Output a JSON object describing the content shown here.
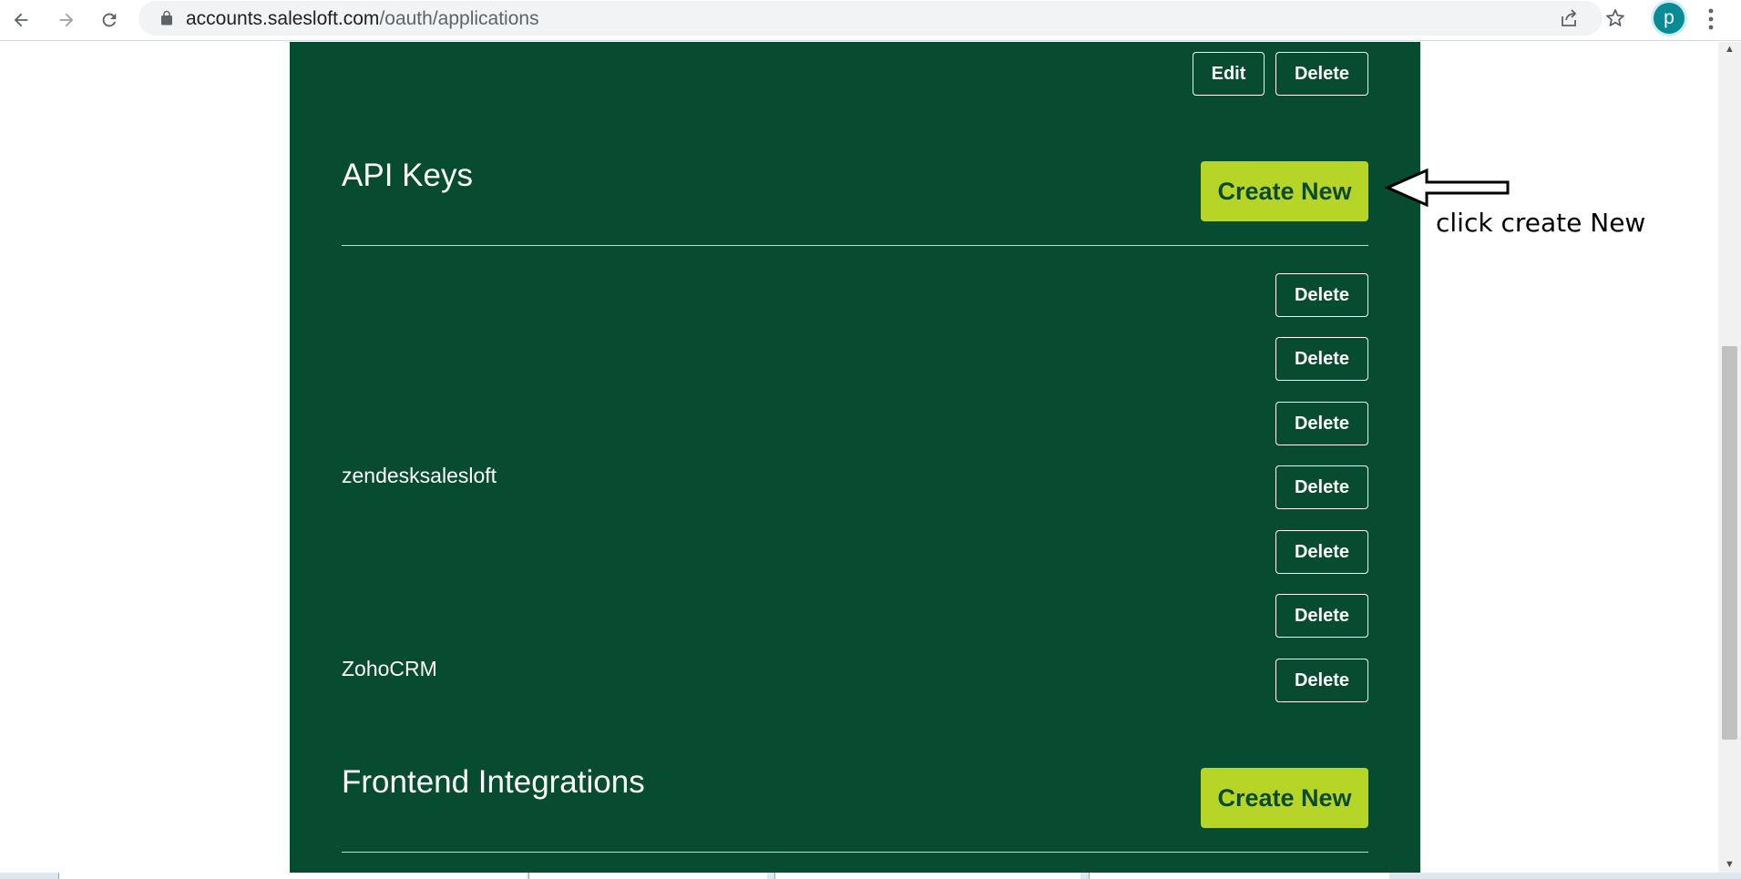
{
  "browser": {
    "url_domain": "accounts.salesloft.com",
    "url_path": "/oauth/applications",
    "profile_initial": "p"
  },
  "top_actions": {
    "edit_label": "Edit",
    "delete_label": "Delete"
  },
  "api_keys": {
    "title": "API Keys",
    "create_label": "Create New",
    "rows": [
      {
        "name": "",
        "delete_label": "Delete"
      },
      {
        "name": "",
        "delete_label": "Delete"
      },
      {
        "name": "",
        "delete_label": "Delete"
      },
      {
        "name": "zendesksalesloft",
        "delete_label": "Delete"
      },
      {
        "name": "",
        "delete_label": "Delete"
      },
      {
        "name": "",
        "delete_label": "Delete"
      },
      {
        "name": "ZohoCRM",
        "delete_label": "Delete"
      }
    ]
  },
  "frontend_integrations": {
    "title": "Frontend Integrations",
    "create_label": "Create New"
  },
  "annotation": {
    "text": "click create New"
  },
  "colors": {
    "panel_bg": "#074b30",
    "primary_button": "#b7d527",
    "primary_text": "#0c4a2d",
    "avatar": "#0a8a94"
  }
}
